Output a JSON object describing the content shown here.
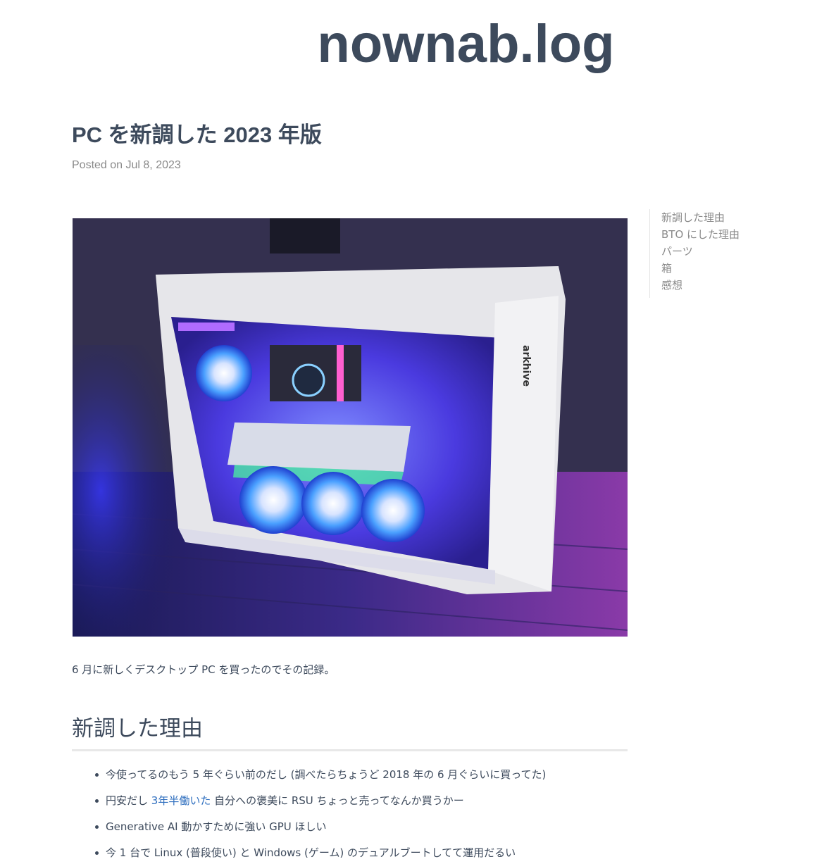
{
  "site": {
    "title": "nownab.log"
  },
  "post": {
    "title": "PC を新調した 2023 年版",
    "meta": "Posted on Jul 8, 2023",
    "image_label": "arkhive",
    "intro": "6 月に新しくデスクトップ PC を買ったのでその記録。"
  },
  "toc": {
    "items": [
      {
        "label": "新調した理由"
      },
      {
        "label": "BTO にした理由"
      },
      {
        "label": "パーツ"
      },
      {
        "label": "箱"
      },
      {
        "label": "感想"
      }
    ]
  },
  "section1": {
    "heading": "新調した理由",
    "items": [
      {
        "text": "今使ってるのもう 5 年ぐらい前のだし (調べたらちょうど 2018 年の 6 月ぐらいに買ってた)"
      },
      {
        "before": "円安だし ",
        "link": "3年半働いた",
        "after": " 自分への褒美に RSU ちょっと売ってなんか買うかー"
      },
      {
        "text": "Generative AI 動かすために強い GPU ほしい"
      },
      {
        "text": "今 1 台で Linux (普段使い) と Windows (ゲーム) のデュアルブートしてて運用だるい"
      }
    ]
  },
  "colors": {
    "text": "#3d4a5c",
    "muted": "#8a8a8a",
    "link": "#2f6fbf"
  }
}
